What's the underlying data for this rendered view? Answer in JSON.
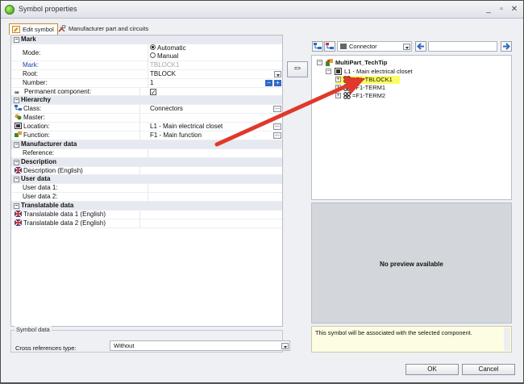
{
  "window": {
    "title": "Symbol properties",
    "minimize": "_",
    "restore": "▫",
    "close": "✕"
  },
  "tabs": [
    {
      "label": "Edit symbol"
    },
    {
      "label": "Manufacturer part and circuits"
    }
  ],
  "properties": {
    "mark": {
      "header": "Mark",
      "mode_label": "Mode:",
      "mode_automatic": "Automatic",
      "mode_manual": "Manual",
      "mark_label": "Mark:",
      "mark_value": "TBLOCK1",
      "root_label": "Root:",
      "root_value": "TBLOCK",
      "number_label": "Number:",
      "number_value": "1",
      "permanent_label": "Permanent component:",
      "permanent_check": "✓"
    },
    "hierarchy": {
      "header": "Hierarchy",
      "class_label": "Class:",
      "class_value": "Connectors",
      "master_label": "Master:",
      "master_value": "",
      "location_label": "Location:",
      "location_value": "L1 - Main electrical closet",
      "function_label": "Function:",
      "function_value": "F1 - Main function"
    },
    "manufacturer": {
      "header": "Manufacturer data",
      "reference_label": "Reference:"
    },
    "description": {
      "header": "Description",
      "desc_label": "Description (English)"
    },
    "user": {
      "header": "User data",
      "user1_label": "User data 1:",
      "user2_label": "User data 2:"
    },
    "translatable": {
      "header": "Translatable data",
      "t1_label": "Translatable data 1 (English)",
      "t2_label": "Translatable data 2 (English)"
    },
    "dots": "...",
    "collapse": "−",
    "spin_minus": "−",
    "spin_plus": "+"
  },
  "symbol_data": {
    "legend": "Symbol data",
    "xref_label": "Cross references type:",
    "xref_value": "Without"
  },
  "assoc_button": "=>",
  "toolbar": {
    "combo_value": "Connector"
  },
  "tree": {
    "root": "MultiPart_TechTip",
    "location": "L1 - Main electrical closet",
    "items": [
      "=F1-TBLOCK1",
      "=F1-TERM1",
      "=F1-TERM2"
    ],
    "expand_minus": "−",
    "expand_plus": "+"
  },
  "preview": {
    "text": "No preview available"
  },
  "info": {
    "text": "This symbol will be associated with the selected component."
  },
  "buttons": {
    "ok": "OK",
    "cancel": "Cancel"
  },
  "colors": {
    "highlight": "#fdfd66",
    "accent_blue": "#2f6ac7",
    "arrow_red": "#e0392b"
  }
}
